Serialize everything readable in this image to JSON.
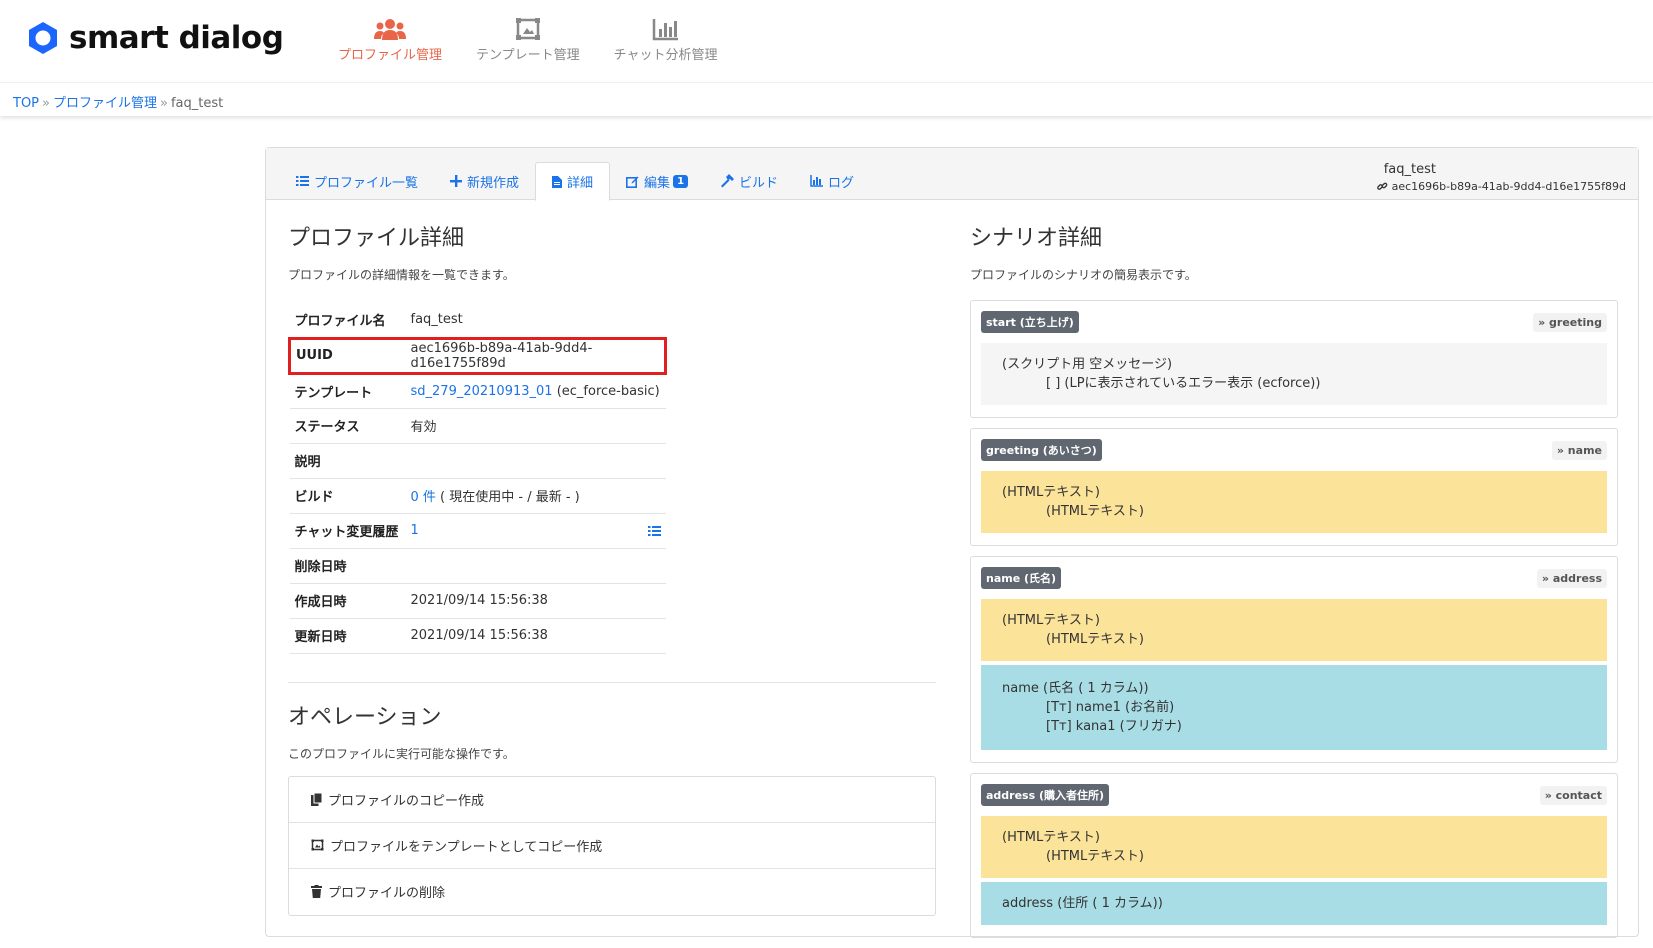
{
  "header": {
    "logo_text": "smart dialog",
    "nav": [
      {
        "label": "プロファイル管理",
        "icon": "users-icon",
        "active": true
      },
      {
        "label": "テンプレート管理",
        "icon": "template-icon",
        "active": false
      },
      {
        "label": "チャット分析管理",
        "icon": "chart-icon",
        "active": false
      }
    ],
    "accent_color": "#e8654a",
    "link_color": "#1a73e8"
  },
  "breadcrumb": {
    "top": "TOP",
    "profile": "プロファイル管理",
    "current": "faq_test",
    "sep": "»"
  },
  "tabs": [
    {
      "label": "プロファイル一覧",
      "icon": "list-icon"
    },
    {
      "label": "新規作成",
      "icon": "plus-icon"
    },
    {
      "label": "詳細",
      "icon": "document-icon",
      "active": true
    },
    {
      "label": "編集",
      "icon": "edit-icon",
      "badge": "1"
    },
    {
      "label": "ビルド",
      "icon": "hammer-icon"
    },
    {
      "label": "ログ",
      "icon": "chart-icon"
    }
  ],
  "tab_right": {
    "name": "faq_test",
    "uuid": "aec1696b-b89a-41ab-9dd4-d16e1755f89d"
  },
  "detail": {
    "title": "プロファイル詳細",
    "desc": "プロファイルの詳細情報を一覧できます。",
    "rows": {
      "name": {
        "k": "プロファイル名",
        "v": "faq_test"
      },
      "uuid": {
        "k": "UUID",
        "v": "aec1696b-b89a-41ab-9dd4-d16e1755f89d"
      },
      "template": {
        "k": "テンプレート",
        "link": "sd_279_20210913_01",
        "extra": "(ec_force-basic)"
      },
      "status": {
        "k": "ステータス",
        "v": "有効"
      },
      "desc": {
        "k": "説明",
        "v": ""
      },
      "build": {
        "k": "ビルド",
        "link": "0 件",
        "extra": "( 現在使用中 - / 最新 - )"
      },
      "history": {
        "k": "チャット変更履歴",
        "link": "1"
      },
      "deleted": {
        "k": "削除日時",
        "v": ""
      },
      "created": {
        "k": "作成日時",
        "v": "2021/09/14 15:56:38"
      },
      "updated": {
        "k": "更新日時",
        "v": "2021/09/14 15:56:38"
      }
    }
  },
  "operation": {
    "title": "オペレーション",
    "desc": "このプロファイルに実行可能な操作です。",
    "items": [
      {
        "label": "プロファイルのコピー作成",
        "icon": "copy-icon"
      },
      {
        "label": "プロファイルをテンプレートとしてコピー作成",
        "icon": "template-icon"
      },
      {
        "label": "プロファイルの削除",
        "icon": "trash-icon"
      }
    ]
  },
  "scenario": {
    "title": "シナリオ詳細",
    "desc": "プロファイルのシナリオの簡易表示です。",
    "blocks": [
      {
        "label": "start (立ち上げ)",
        "next": "» greeting",
        "bodies": [
          {
            "color": "gray",
            "l1": "(スクリプト用 空メッセージ)",
            "l2": "[ ] (LPに表示されているエラー表示 (ecforce))",
            "l2_icon": "bracket-icon"
          }
        ]
      },
      {
        "label": "greeting (あいさつ)",
        "next": "» name",
        "bodies": [
          {
            "color": "yellow",
            "l1": "(HTMLテキスト)",
            "l2": "(HTMLテキスト)"
          }
        ]
      },
      {
        "label": "name (氏名)",
        "next": "» address",
        "bodies": [
          {
            "color": "yellow",
            "l1": "(HTMLテキスト)",
            "l2": "(HTMLテキスト)"
          },
          {
            "color": "blue",
            "l1": "name (氏名 ( 1 カラム))",
            "l2": "[Tт] name1 (お名前)",
            "l3": "[Tт] kana1 (フリガナ)"
          }
        ]
      },
      {
        "label": "address (購入者住所)",
        "next": "» contact",
        "bodies": [
          {
            "color": "yellow",
            "l1": "(HTMLテキスト)",
            "l2": "(HTMLテキスト)"
          },
          {
            "color": "blue",
            "l1": "address (住所 ( 1 カラム))"
          }
        ]
      }
    ]
  }
}
